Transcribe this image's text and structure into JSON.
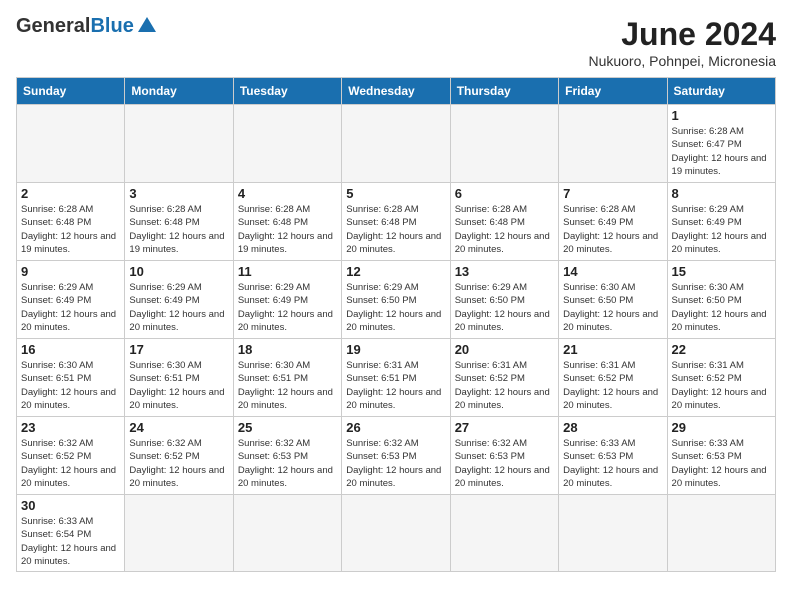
{
  "logo": {
    "text_general": "General",
    "text_blue": "Blue"
  },
  "header": {
    "month_year": "June 2024",
    "location": "Nukuoro, Pohnpei, Micronesia"
  },
  "weekdays": [
    "Sunday",
    "Monday",
    "Tuesday",
    "Wednesday",
    "Thursday",
    "Friday",
    "Saturday"
  ],
  "weeks": [
    [
      {
        "day": "",
        "info": ""
      },
      {
        "day": "",
        "info": ""
      },
      {
        "day": "",
        "info": ""
      },
      {
        "day": "",
        "info": ""
      },
      {
        "day": "",
        "info": ""
      },
      {
        "day": "",
        "info": ""
      },
      {
        "day": "1",
        "info": "Sunrise: 6:28 AM\nSunset: 6:47 PM\nDaylight: 12 hours and 19 minutes."
      }
    ],
    [
      {
        "day": "2",
        "info": "Sunrise: 6:28 AM\nSunset: 6:48 PM\nDaylight: 12 hours and 19 minutes."
      },
      {
        "day": "3",
        "info": "Sunrise: 6:28 AM\nSunset: 6:48 PM\nDaylight: 12 hours and 19 minutes."
      },
      {
        "day": "4",
        "info": "Sunrise: 6:28 AM\nSunset: 6:48 PM\nDaylight: 12 hours and 19 minutes."
      },
      {
        "day": "5",
        "info": "Sunrise: 6:28 AM\nSunset: 6:48 PM\nDaylight: 12 hours and 20 minutes."
      },
      {
        "day": "6",
        "info": "Sunrise: 6:28 AM\nSunset: 6:48 PM\nDaylight: 12 hours and 20 minutes."
      },
      {
        "day": "7",
        "info": "Sunrise: 6:28 AM\nSunset: 6:49 PM\nDaylight: 12 hours and 20 minutes."
      },
      {
        "day": "8",
        "info": "Sunrise: 6:29 AM\nSunset: 6:49 PM\nDaylight: 12 hours and 20 minutes."
      }
    ],
    [
      {
        "day": "9",
        "info": "Sunrise: 6:29 AM\nSunset: 6:49 PM\nDaylight: 12 hours and 20 minutes."
      },
      {
        "day": "10",
        "info": "Sunrise: 6:29 AM\nSunset: 6:49 PM\nDaylight: 12 hours and 20 minutes."
      },
      {
        "day": "11",
        "info": "Sunrise: 6:29 AM\nSunset: 6:49 PM\nDaylight: 12 hours and 20 minutes."
      },
      {
        "day": "12",
        "info": "Sunrise: 6:29 AM\nSunset: 6:50 PM\nDaylight: 12 hours and 20 minutes."
      },
      {
        "day": "13",
        "info": "Sunrise: 6:29 AM\nSunset: 6:50 PM\nDaylight: 12 hours and 20 minutes."
      },
      {
        "day": "14",
        "info": "Sunrise: 6:30 AM\nSunset: 6:50 PM\nDaylight: 12 hours and 20 minutes."
      },
      {
        "day": "15",
        "info": "Sunrise: 6:30 AM\nSunset: 6:50 PM\nDaylight: 12 hours and 20 minutes."
      }
    ],
    [
      {
        "day": "16",
        "info": "Sunrise: 6:30 AM\nSunset: 6:51 PM\nDaylight: 12 hours and 20 minutes."
      },
      {
        "day": "17",
        "info": "Sunrise: 6:30 AM\nSunset: 6:51 PM\nDaylight: 12 hours and 20 minutes."
      },
      {
        "day": "18",
        "info": "Sunrise: 6:30 AM\nSunset: 6:51 PM\nDaylight: 12 hours and 20 minutes."
      },
      {
        "day": "19",
        "info": "Sunrise: 6:31 AM\nSunset: 6:51 PM\nDaylight: 12 hours and 20 minutes."
      },
      {
        "day": "20",
        "info": "Sunrise: 6:31 AM\nSunset: 6:52 PM\nDaylight: 12 hours and 20 minutes."
      },
      {
        "day": "21",
        "info": "Sunrise: 6:31 AM\nSunset: 6:52 PM\nDaylight: 12 hours and 20 minutes."
      },
      {
        "day": "22",
        "info": "Sunrise: 6:31 AM\nSunset: 6:52 PM\nDaylight: 12 hours and 20 minutes."
      }
    ],
    [
      {
        "day": "23",
        "info": "Sunrise: 6:32 AM\nSunset: 6:52 PM\nDaylight: 12 hours and 20 minutes."
      },
      {
        "day": "24",
        "info": "Sunrise: 6:32 AM\nSunset: 6:52 PM\nDaylight: 12 hours and 20 minutes."
      },
      {
        "day": "25",
        "info": "Sunrise: 6:32 AM\nSunset: 6:53 PM\nDaylight: 12 hours and 20 minutes."
      },
      {
        "day": "26",
        "info": "Sunrise: 6:32 AM\nSunset: 6:53 PM\nDaylight: 12 hours and 20 minutes."
      },
      {
        "day": "27",
        "info": "Sunrise: 6:32 AM\nSunset: 6:53 PM\nDaylight: 12 hours and 20 minutes."
      },
      {
        "day": "28",
        "info": "Sunrise: 6:33 AM\nSunset: 6:53 PM\nDaylight: 12 hours and 20 minutes."
      },
      {
        "day": "29",
        "info": "Sunrise: 6:33 AM\nSunset: 6:53 PM\nDaylight: 12 hours and 20 minutes."
      }
    ],
    [
      {
        "day": "30",
        "info": "Sunrise: 6:33 AM\nSunset: 6:54 PM\nDaylight: 12 hours and 20 minutes."
      },
      {
        "day": "",
        "info": ""
      },
      {
        "day": "",
        "info": ""
      },
      {
        "day": "",
        "info": ""
      },
      {
        "day": "",
        "info": ""
      },
      {
        "day": "",
        "info": ""
      },
      {
        "day": "",
        "info": ""
      }
    ]
  ]
}
